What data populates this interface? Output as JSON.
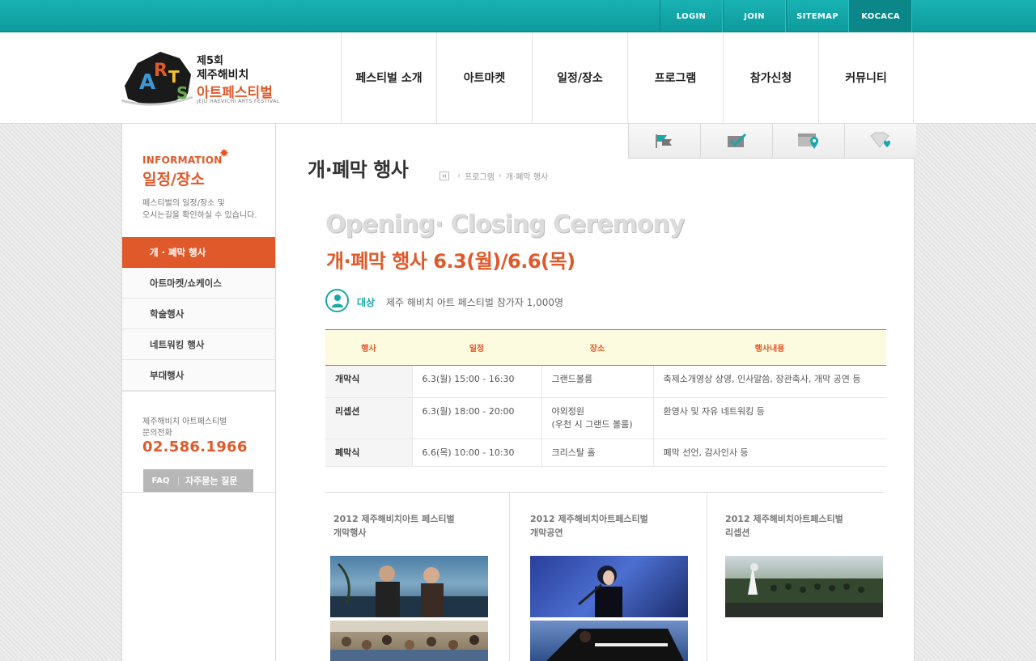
{
  "toplinks": [
    "LOGIN",
    "JOIN",
    "SITEMAP",
    "KOCACA"
  ],
  "logo": {
    "line1": "제5회",
    "line2": "제주해비치",
    "line3": "아트페스티벌",
    "line4": "JEJU HAEVICHI ARTS FESTIVAL",
    "mark_letters": [
      "A",
      "R",
      "T",
      "S"
    ]
  },
  "gnb": [
    "페스티벌 소개",
    "아트마켓",
    "일정/장소",
    "프로그램",
    "참가신청",
    "커뮤니티"
  ],
  "sidebar": {
    "info": "INFORMATION",
    "title": "일정/장소",
    "desc1": "페스티벌의 일정/장소 및",
    "desc2": "오시는길을 확인하실 수 있습니다.",
    "menu": [
      "개 · 폐막 행사",
      "아트마켓/쇼케이스",
      "학술행사",
      "네트워킹 행사",
      "부대행사"
    ],
    "contact1": "제주해비치 아트페스티벌",
    "contact2": "문의전화",
    "phone": "02.586.1966",
    "faq_a": "FAQ",
    "faq_b": "자주묻는 질문"
  },
  "quick_icons": [
    "flag-icon",
    "check-mail-icon",
    "map-pin-icon",
    "diamond-heart-icon"
  ],
  "content": {
    "page_title": "개·폐막 행사",
    "breadcrumb_home": "H",
    "breadcrumb": [
      "프로그램",
      "개·폐막 행사"
    ],
    "en_title": "Opening· Closing Ceremony",
    "ko_title": "개·폐막 행사  6.3(월)/6.6(목)",
    "target_label": "대상",
    "target_text": "제주 해비치 아트 페스티벌 참가자 1,000명",
    "table": {
      "headers": [
        "행사",
        "일정",
        "장소",
        "행사내용"
      ],
      "rows": [
        [
          "개막식",
          "6.3(월) 15:00 - 16:30",
          "그랜드볼룸",
          "축제소개영상 상영, 인사말씀, 장관축사, 개막 공연 등"
        ],
        [
          "리셉션",
          "6.3(월) 18:00 - 20:00",
          "야외정원\n(우천 시 그랜드 볼룸)",
          "환영사 및 자유 네트워킹 등"
        ],
        [
          "폐막식",
          "6.6(목) 10:00 - 10:30",
          "크리스탈 홀",
          "폐막 선언, 감사인사 등"
        ]
      ]
    },
    "gallery": [
      {
        "line1": "2012 제주해비치아트 페스티벌",
        "line2": "개막행사"
      },
      {
        "line1": "2012 제주해비치아트페스티벌",
        "line2": "개막공연"
      },
      {
        "line1": "2012 제주해비치아트페스티벌",
        "line2": "리셉션"
      }
    ]
  },
  "colors": {
    "teal": "#1aa7a8",
    "orange": "#e0592a"
  }
}
